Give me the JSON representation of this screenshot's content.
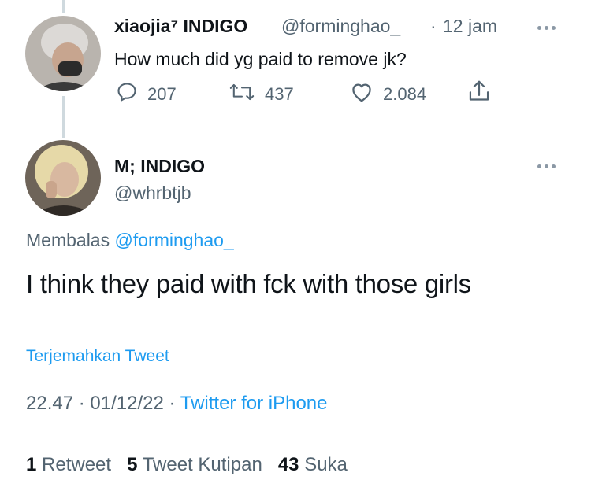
{
  "reply_parent": {
    "display_name": "xiaojia⁷ INDIGO",
    "handle": "@forminghao_",
    "separator": "·",
    "time": "12 jam",
    "text": "How much did yg paid to remove jk?",
    "actions": {
      "replies": "207",
      "retweets": "437",
      "likes": "2.084"
    }
  },
  "main_tweet": {
    "display_name": "M; INDIGO",
    "handle": "@whrbtjb",
    "replying_prefix": "Membalas",
    "replying_to": "@forminghao_",
    "text": "I think they paid with fck with those girls",
    "translate_label": "Terjemahkan Tweet",
    "time": "22.47",
    "dot1": "·",
    "date": "01/12/22",
    "dot2": "·",
    "source": "Twitter for iPhone"
  },
  "stats": {
    "retweets_count": "1",
    "retweets_label": "Retweet",
    "quotes_count": "5",
    "quotes_label": "Tweet Kutipan",
    "likes_count": "43",
    "likes_label": "Suka"
  },
  "colors": {
    "accent": "#1d9bf0",
    "muted": "#536471",
    "text": "#0f1419",
    "line": "#cfd9de"
  }
}
